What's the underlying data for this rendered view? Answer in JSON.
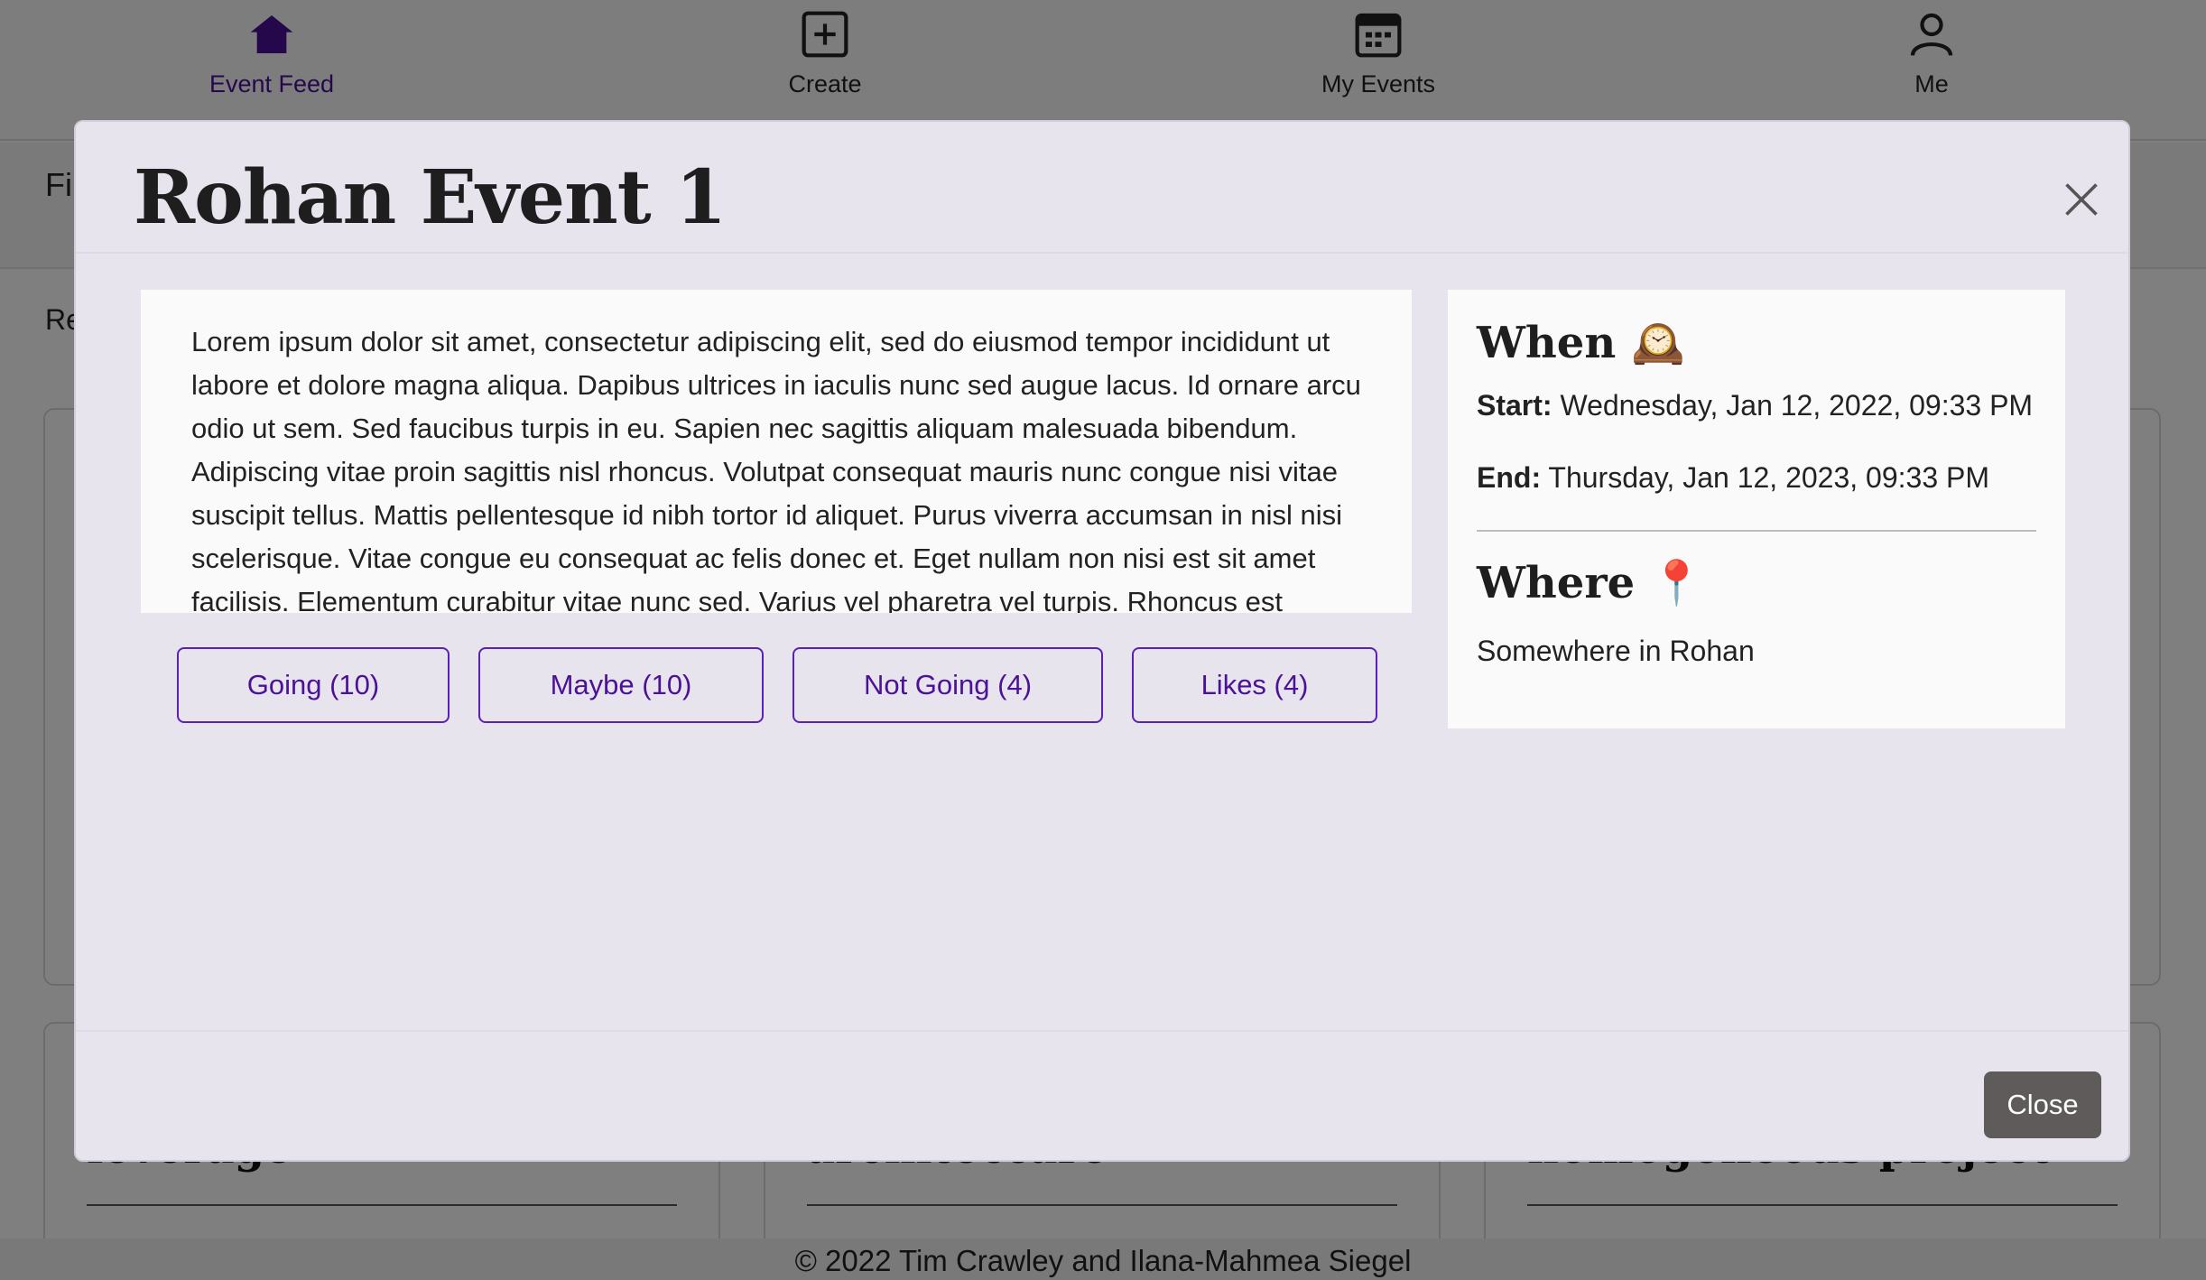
{
  "nav": {
    "items": [
      {
        "label": "Event Feed",
        "icon": "home-icon"
      },
      {
        "label": "Create",
        "icon": "plus-square-icon"
      },
      {
        "label": "My Events",
        "icon": "calendar-icon"
      },
      {
        "label": "Me",
        "icon": "person-icon"
      }
    ],
    "active_color": "#4b1196"
  },
  "background": {
    "filter_label": "Fi",
    "results_label": "Re",
    "cards": [
      {
        "title": "leverage"
      },
      {
        "title": "architecture"
      },
      {
        "title": "homogeneous project"
      }
    ]
  },
  "modal": {
    "title": "Rohan Event 1",
    "description": "Lorem ipsum dolor sit amet, consectetur adipiscing elit, sed do eiusmod tempor incididunt ut labore et dolore magna aliqua. Dapibus ultrices in iaculis nunc sed augue lacus. Id ornare arcu odio ut sem. Sed faucibus turpis in eu. Sapien nec sagittis aliquam malesuada bibendum. Adipiscing vitae proin sagittis nisl rhoncus. Volutpat consequat mauris nunc congue nisi vitae suscipit tellus. Mattis pellentesque id nibh tortor id aliquet. Purus viverra accumsan in nisl nisi scelerisque. Vitae congue eu consequat ac felis donec et. Eget nullam non nisi est sit amet facilisis. Elementum curabitur vitae nunc sed. Varius vel pharetra vel turpis. Rhoncus est",
    "buttons": {
      "going": "Going (10)",
      "maybe": "Maybe (10)",
      "not_going": "Not Going (4)",
      "likes": "Likes (4)"
    },
    "when": {
      "heading": "When 🕰️",
      "start_label": "Start:",
      "start_value": "Wednesday, Jan 12, 2022, 09:33 PM",
      "end_label": "End:",
      "end_value": "Thursday, Jan 12, 2023, 09:33 PM"
    },
    "where": {
      "heading": "Where 📍",
      "location": "Somewhere in Rohan"
    },
    "close_label": "Close",
    "accent_color": "#5b21b6"
  },
  "footer": {
    "text": "© 2022 Tim Crawley and Ilana-Mahmea Siegel"
  }
}
